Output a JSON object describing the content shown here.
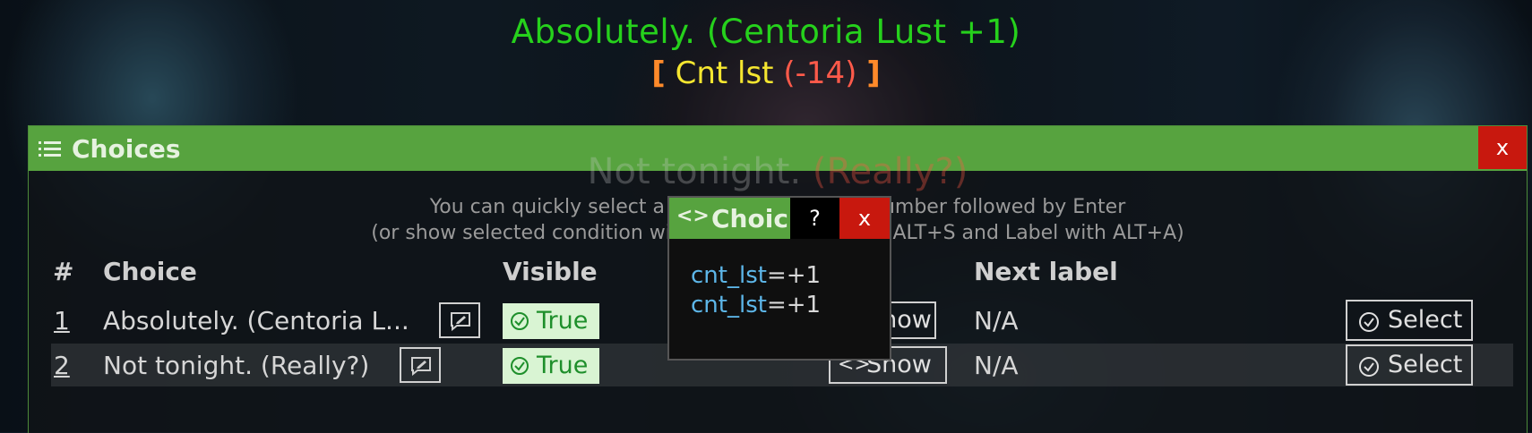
{
  "notification": {
    "line1": "Absolutely. (Centoria Lust +1)",
    "line2": {
      "open_bracket": "[",
      "stat": "Cnt lst",
      "change": "(-14)",
      "close_bracket": "]"
    }
  },
  "choices_window": {
    "title": "Choices",
    "close_label": "x",
    "ghost_text": {
      "main": "Not tonight.",
      "suffix": "(Really?)"
    },
    "hint_line1": "You can quickly select a choice by typing its number followed by Enter",
    "hint_line2": "(or show selected condition with ALT+C, Visible with ALT+S and Label with ALT+A)",
    "columns": {
      "num": "#",
      "choice": "Choice",
      "visible": "Visible",
      "next_label": "Next label"
    },
    "rows": [
      {
        "num": "1",
        "choice": "Absolutely. (Centoria L...",
        "visible": "True",
        "condition_label": "Show",
        "next_label": "N/A",
        "select_label": "Select"
      },
      {
        "num": "2",
        "choice": "Not tonight. (Really?)",
        "visible": "True",
        "condition_label": "Show",
        "next_label": "N/A",
        "select_label": "Select"
      }
    ]
  },
  "condition_popup": {
    "title": "Choic",
    "help_label": "?",
    "close_label": "x",
    "lines": [
      {
        "var": "cnt_lst",
        "op": "=+1"
      },
      {
        "var": "cnt_lst",
        "op": "=+1"
      }
    ]
  },
  "colors": {
    "accent_green": "#57a33f",
    "close_red": "#c8180e",
    "notification_green": "#26d11c",
    "true_badge_bg": "#d9f4d3",
    "variable_blue": "#5db6e8"
  }
}
